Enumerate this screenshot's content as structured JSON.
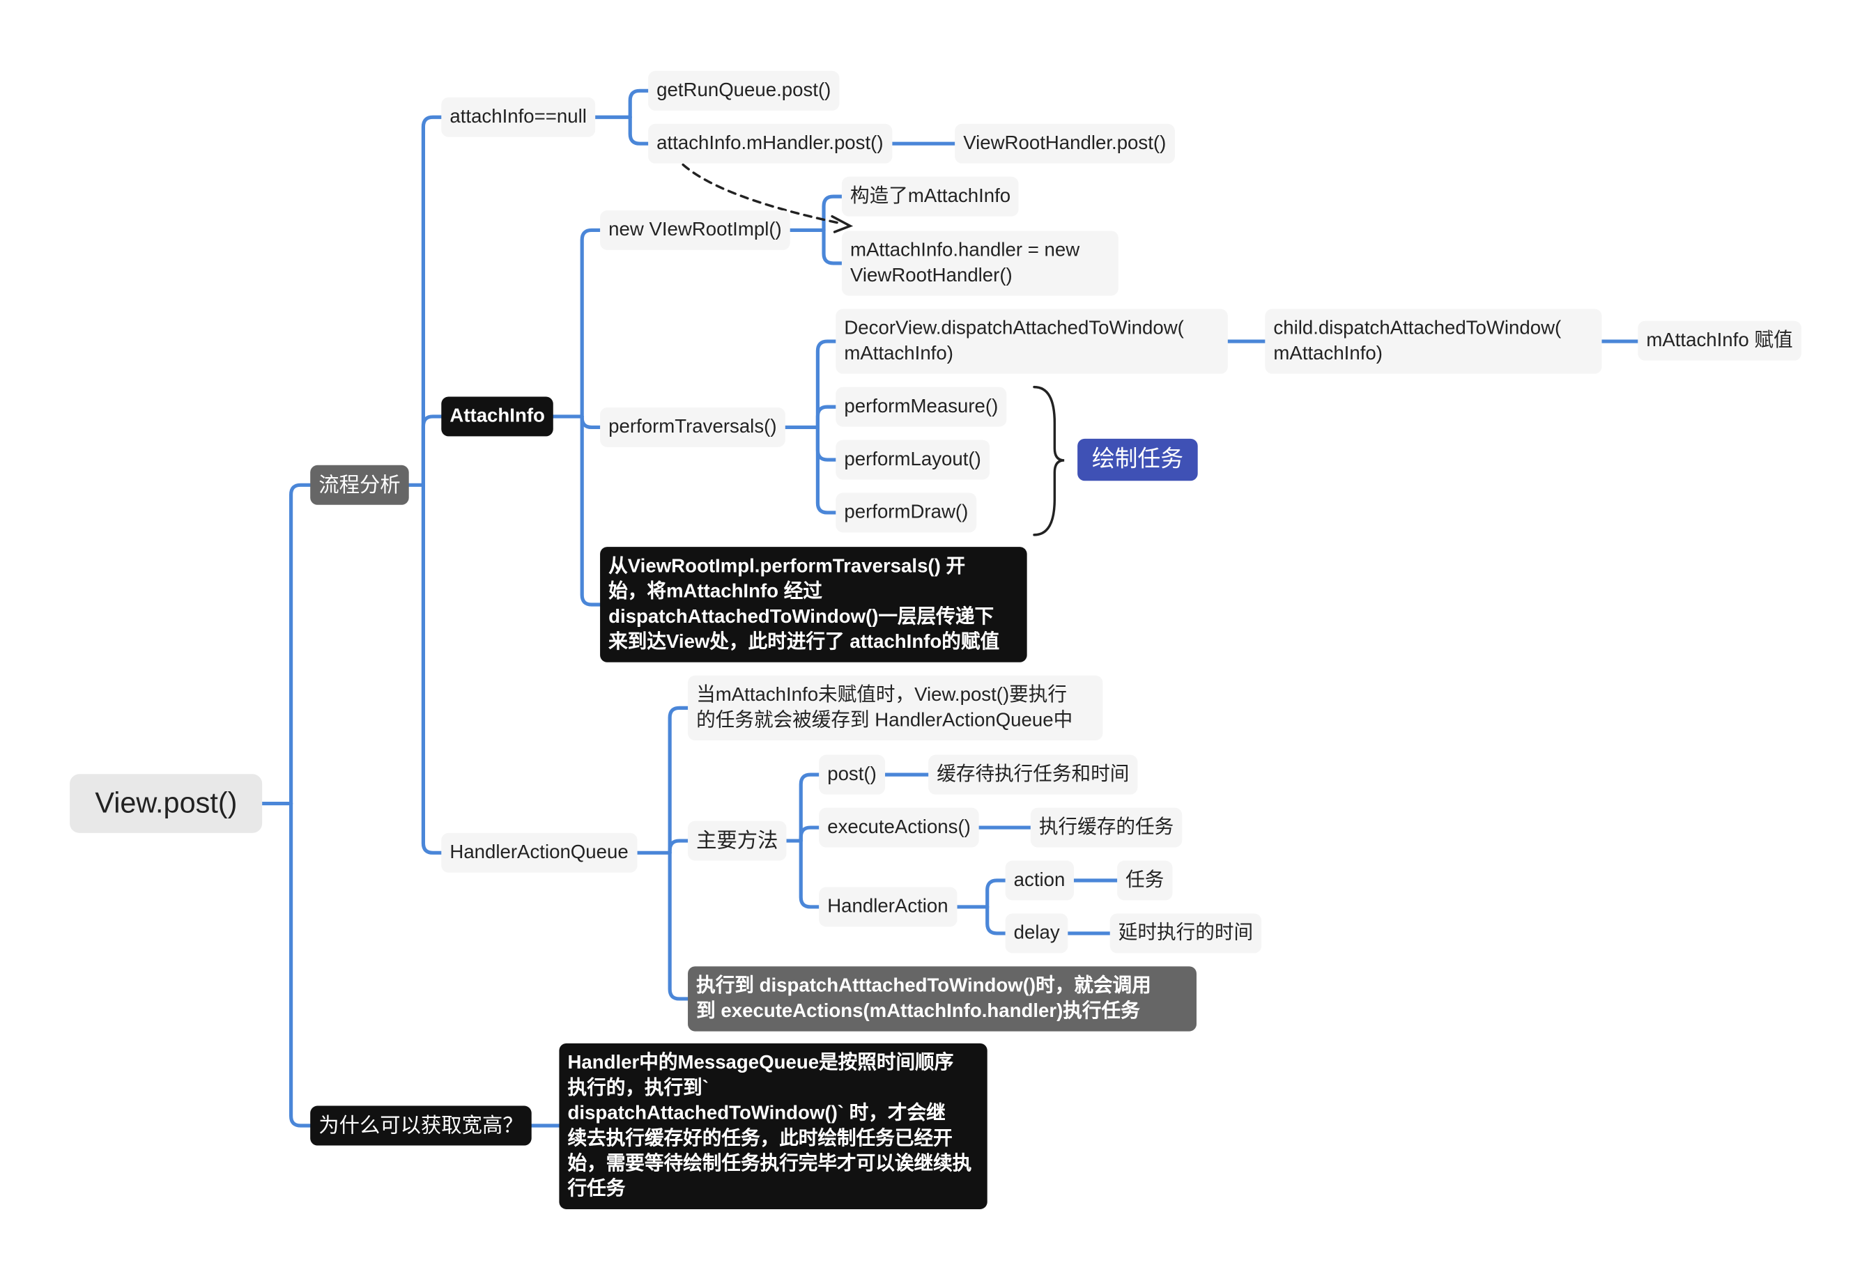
{
  "colors": {
    "connector": "#4a86d8",
    "blue_node": "#3f51b5",
    "dark_node": "#111111",
    "gray_node": "#666666",
    "light_node": "#f5f5f5"
  },
  "root": "View.post()",
  "branches": {
    "flow": "流程分析",
    "why": "为什么可以获取宽高？"
  },
  "flow": {
    "attach_null": "attachInfo==null",
    "get_run_queue": "getRunQueue.post()",
    "mhandler_post": "attachInfo.mHandler.post()",
    "viewroot_handler_post": "ViewRootHandler.post()",
    "attachinfo": "AttachInfo",
    "new_viewrootimpl": "new VIewRootImpl()",
    "constructed": "构造了mAttachInfo",
    "handler_assign": "mAttachInfo.handler = new\nViewRootHandler()",
    "perform_traversals": "performTraversals()",
    "decor_dispatch": "DecorView.dispatchAttachedToWindow(\nmAttachInfo)",
    "child_dispatch": "child.dispatchAttachedToWindow(\nmAttachInfo)",
    "assign": "mAttachInfo 赋值",
    "perform_measure": "performMeasure()",
    "perform_layout": "performLayout()",
    "perform_draw": "performDraw()",
    "draw_task": "绘制任务",
    "attach_note": "从ViewRootImpl.performTraversals() 开\n始，将mAttachInfo 经过\ndispatchAttachedToWindow()一层层传递下\n来到达View处，此时进行了 attachInfo的赋值",
    "haq": "HandlerActionQueue",
    "haq_desc": "当mAttachInfo未赋值时，View.post()要执行\n的任务就会被缓存到 HandlerActionQueue中",
    "main_methods": "主要方法",
    "post": "post()",
    "post_desc": "缓存待执行任务和时间",
    "execute_actions": "executeActions()",
    "execute_desc": "执行缓存的任务",
    "handler_action": "HandlerAction",
    "action": "action",
    "action_desc": "任务",
    "delay": "delay",
    "delay_desc": "延时执行的时间",
    "haq_note": "执行到 dispatchAtttachedToWindow()时，就会调用\n到 executeActions(mAttachInfo.handler)执行任务"
  },
  "why_note": "Handler中的MessageQueue是按照时间顺序\n执行的，执行到`\ndispatchAttachedToWindow()` 时，才会继\n续去执行缓存好的任务，此时绘制任务已经开\n始，需要等待绘制任务执行完毕才可以诶继续执\n行任务"
}
